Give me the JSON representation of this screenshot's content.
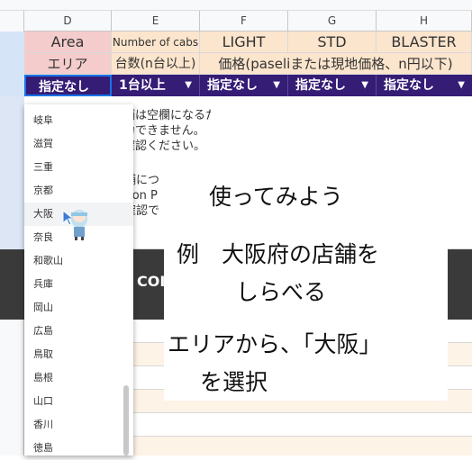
{
  "columns": [
    "D",
    "E",
    "F",
    "G",
    "H"
  ],
  "header_row1": {
    "d": "Area",
    "e": "Number of cabs",
    "f": "LIGHT",
    "g": "STD",
    "h": "BLASTER"
  },
  "header_row2": {
    "d": "エリア",
    "e": "台数(n台以上)",
    "f": "価格(paseliまたは現地価格、n円以下)"
  },
  "filter_row": {
    "d": "指定なし",
    "e": "1台以上",
    "f": "指定なし",
    "g": "指定なし",
    "h": "指定なし",
    "arrow": "▼"
  },
  "notice": {
    "line1": "店舗は空欄になるため、",
    "line2": "出力できません。",
    "line3": "ご確認ください。",
    "line4": "舗につ",
    "line5": "tion P",
    "line6": "確認で"
  },
  "band_text": "COI",
  "dropdown_items": [
    "岐阜",
    "滋賀",
    "三重",
    "京都",
    "大阪",
    "奈良",
    "和歌山",
    "兵庫",
    "岡山",
    "広島",
    "鳥取",
    "島根",
    "山口",
    "香川",
    "徳島"
  ],
  "note": {
    "line1": "使ってみよう",
    "line2": "例　大阪府の店舗を",
    "line3": "しらべる",
    "line4": "エリアから、「大阪」",
    "line5": "を選択"
  },
  "colors": {
    "accent": "#351c75",
    "header_bg": "#fce5cd",
    "band": "#3a3a3a"
  }
}
